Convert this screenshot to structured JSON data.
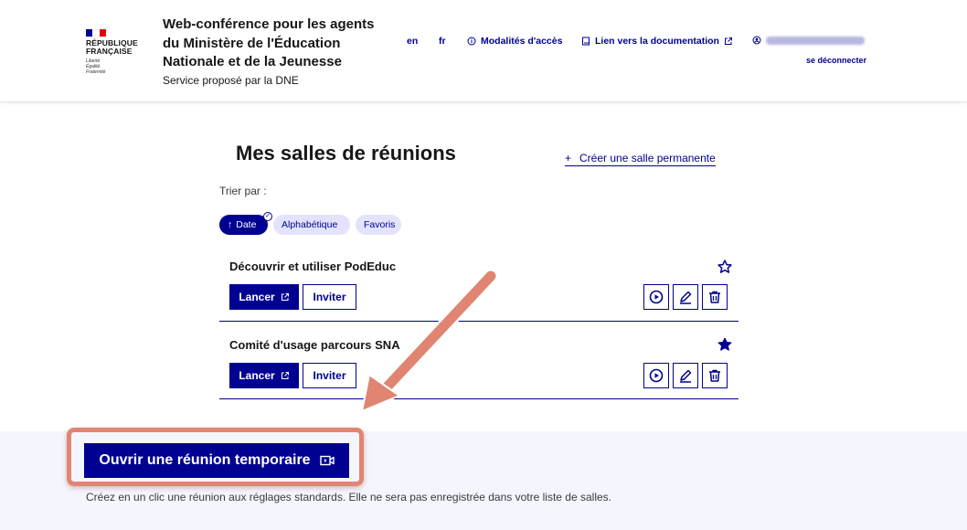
{
  "header": {
    "logo": {
      "title_line1": "RÉPUBLIQUE",
      "title_line2": "FRANÇAISE",
      "motto_line1": "Liberté",
      "motto_line2": "Égalité",
      "motto_line3": "Fraternité",
      "flag_colors": [
        "#000091",
        "#ffffff",
        "#e1000f"
      ]
    },
    "service_title": "Web-conférence pour les agents du Ministère de l'Éducation Nationale et de la Jeunesse",
    "service_subtitle": "Service proposé par la DNE",
    "nav": {
      "lang_en": "en",
      "lang_fr": "fr",
      "access": "Modalités d'accès",
      "documentation": "Lien vers la documentation",
      "logout": "se déconnecter"
    }
  },
  "main": {
    "title": "Mes salles de réunions",
    "create_room": "Créer une salle permanente",
    "sort_label": "Trier par :",
    "sort_options": {
      "date": "Date",
      "alpha": "Alphabétique",
      "favorites": "Favoris"
    },
    "rooms": [
      {
        "name": "Découvrir et utiliser PodEduc",
        "favorite": false
      },
      {
        "name": "Comité d'usage parcours SNA",
        "favorite": true
      }
    ],
    "launch_label": "Lancer",
    "invite_label": "Inviter"
  },
  "temporary": {
    "button_label": "Ouvrir une réunion temporaire",
    "description": "Créez en un clic une réunion aux réglages standards. Elle ne sera pas enregistrée dans votre liste de salles."
  },
  "colors": {
    "primary": "#000091",
    "chip_bg": "#e3e3fd",
    "band_bg": "#f5f5fe",
    "annotation": "#e08572"
  }
}
